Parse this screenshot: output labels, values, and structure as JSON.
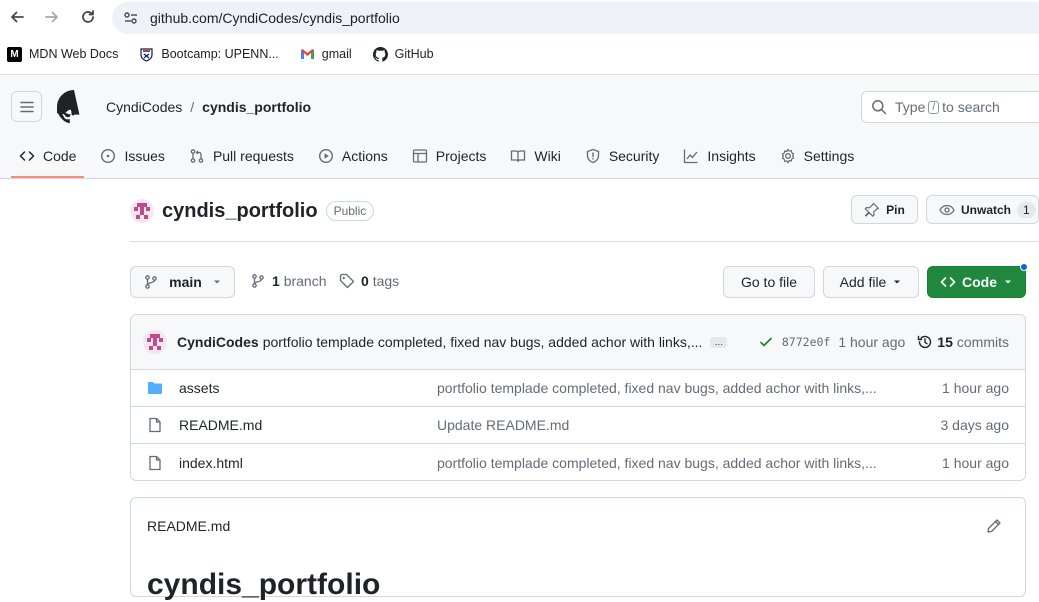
{
  "browser": {
    "url": "github.com/CyndiCodes/cyndis_portfolio",
    "bookmarks": [
      {
        "label": "MDN Web Docs",
        "icon": "mdn-icon"
      },
      {
        "label": "Bootcamp: UPENN...",
        "icon": "upenn-icon"
      },
      {
        "label": "gmail",
        "icon": "gmail-icon"
      },
      {
        "label": "GitHub",
        "icon": "github-icon"
      }
    ]
  },
  "header": {
    "owner": "CyndiCodes",
    "separator": "/",
    "repo": "cyndis_portfolio",
    "search": {
      "prefix": "Type",
      "key": "/",
      "suffix": "to search"
    }
  },
  "tabs": [
    {
      "label": "Code",
      "icon": "code-icon",
      "active": true
    },
    {
      "label": "Issues",
      "icon": "issues-icon"
    },
    {
      "label": "Pull requests",
      "icon": "pull-request-icon"
    },
    {
      "label": "Actions",
      "icon": "play-icon"
    },
    {
      "label": "Projects",
      "icon": "table-icon"
    },
    {
      "label": "Wiki",
      "icon": "book-icon"
    },
    {
      "label": "Security",
      "icon": "shield-icon"
    },
    {
      "label": "Insights",
      "icon": "graph-icon"
    },
    {
      "label": "Settings",
      "icon": "gear-icon"
    }
  ],
  "repo": {
    "name": "cyndis_portfolio",
    "visibility": "Public",
    "pin_label": "Pin",
    "unwatch_label": "Unwatch",
    "watch_count": "1"
  },
  "toolbar": {
    "branch": "main",
    "branch_count": "1",
    "branch_word": "branch",
    "tag_count": "0",
    "tag_word": "tags",
    "go_to_file": "Go to file",
    "add_file": "Add file",
    "code": "Code"
  },
  "latest_commit": {
    "author": "CyndiCodes",
    "message": "portfolio templade completed, fixed nav bugs, added achor with links,...",
    "ellipsis": "…",
    "sha": "8772e0f",
    "time": "1 hour ago",
    "commit_count": "15",
    "commit_word": "commits"
  },
  "files": [
    {
      "name": "assets",
      "type": "folder",
      "message": "portfolio templade completed, fixed nav bugs, added achor with links,...",
      "time": "1 hour ago"
    },
    {
      "name": "README.md",
      "type": "file",
      "message": "Update README.md",
      "time": "3 days ago"
    },
    {
      "name": "index.html",
      "type": "file",
      "message": "portfolio templade completed, fixed nav bugs, added achor with links,...",
      "time": "1 hour ago"
    }
  ],
  "readme": {
    "title": "README.md",
    "heading": "cyndis_portfolio"
  },
  "colors": {
    "accent": "#1f883d",
    "tab_underline": "#fd8c73",
    "folder": "#54aeff",
    "check": "#1a7f37"
  }
}
